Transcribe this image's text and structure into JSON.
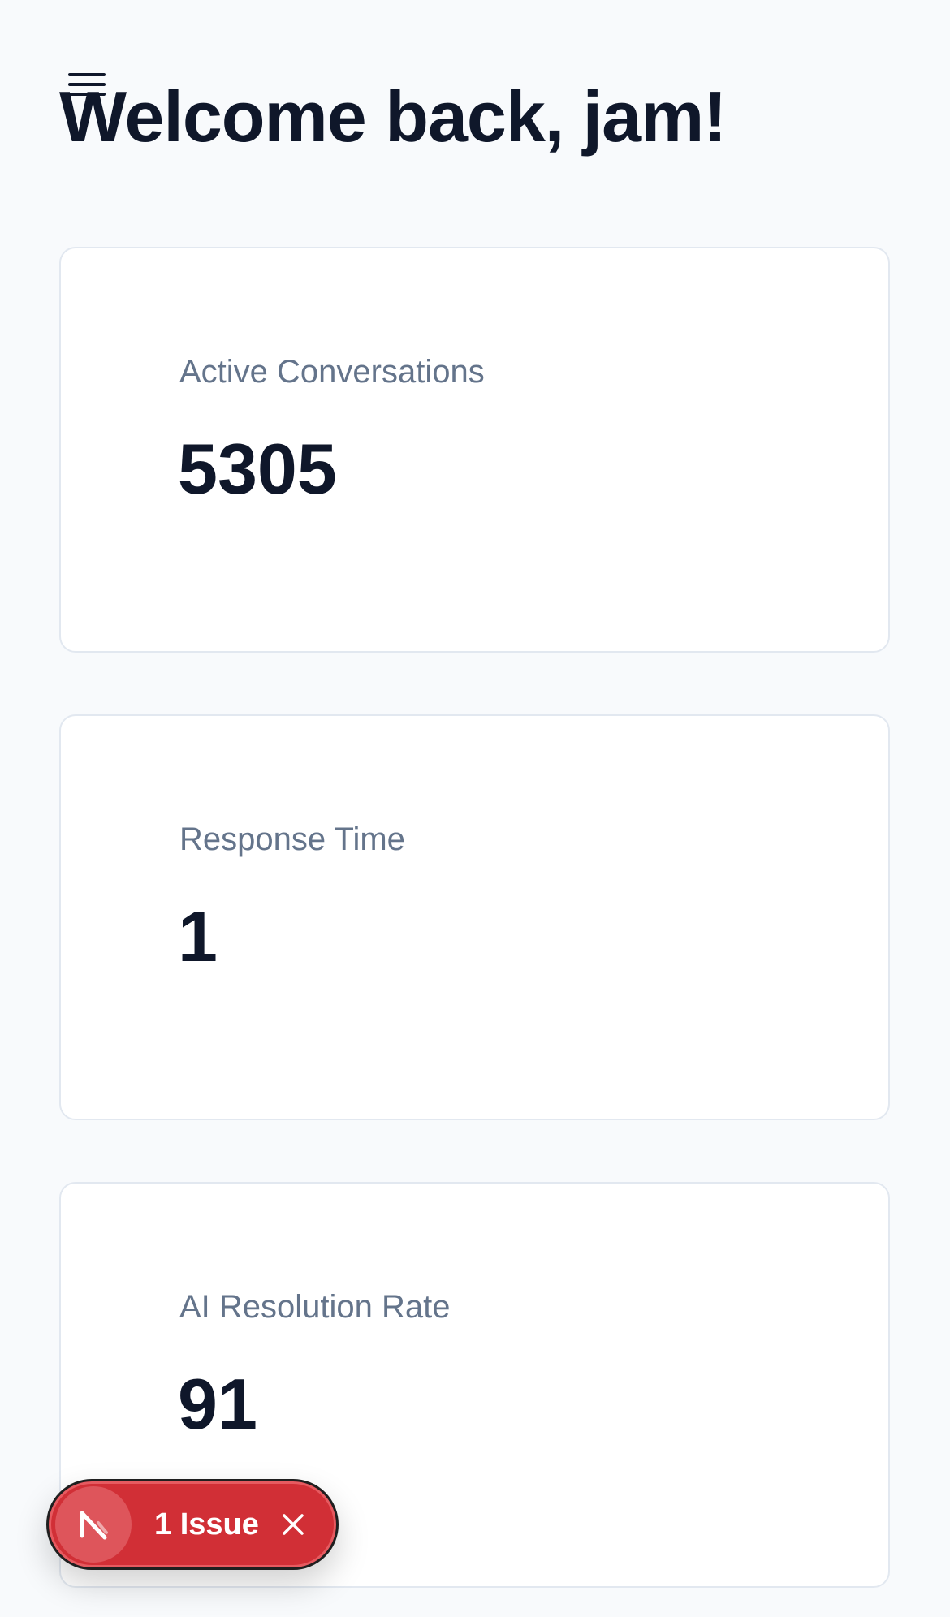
{
  "header": {
    "title": "Welcome back, jam!",
    "menu_icon": "hamburger-menu-icon"
  },
  "stats": [
    {
      "label": "Active Conversations",
      "value": "5305"
    },
    {
      "label": "Response Time",
      "value": "1"
    },
    {
      "label": "AI Resolution Rate",
      "value": "91"
    }
  ],
  "issue_badge": {
    "label": "1 Issue",
    "logo_icon": "nextjs-logo-icon",
    "close_icon": "close-icon",
    "color": "#d12f36"
  },
  "colors": {
    "background": "#f8fafc",
    "card": "#ffffff",
    "text": "#0f172a",
    "muted_text": "#64748b"
  }
}
